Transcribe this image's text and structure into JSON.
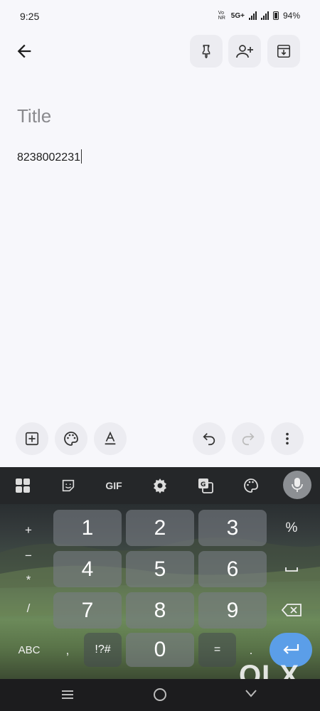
{
  "status_bar": {
    "time": "9:25",
    "network_tag": "Vo NR",
    "network": "5G+",
    "battery": "94%"
  },
  "header": {
    "icons": [
      "back-arrow-icon",
      "pin-icon",
      "add-collaborator-icon",
      "archive-icon"
    ]
  },
  "note": {
    "title_placeholder": "Title",
    "body": "8238002231"
  },
  "editor_toolbar": {
    "left_icons": [
      "add-box-icon",
      "palette-icon",
      "text-format-icon"
    ],
    "right_icons": [
      "undo-icon",
      "redo-icon",
      "more-vert-icon"
    ]
  },
  "keyboard": {
    "toolbar": {
      "gif_label": "GIF",
      "icons": [
        "apps-grid-icon",
        "sticker-icon",
        "gif-icon",
        "settings-icon",
        "translate-icon",
        "theme-palette-icon",
        "mic-icon"
      ]
    },
    "left_column": [
      "+",
      "−",
      "*",
      "/",
      "ABC"
    ],
    "digits": [
      "1",
      "2",
      "3",
      "4",
      "5",
      "6",
      "7",
      "8",
      "9",
      "0"
    ],
    "right_column": [
      "%",
      "␣",
      "⌫",
      "↵"
    ],
    "bottom_row": {
      "comma": ",",
      "symbols": "!?#",
      "equals": "=",
      "period": "."
    }
  },
  "watermark": "OLX",
  "nav_bar": {
    "icons": [
      "recents-icon",
      "home-icon",
      "back-chevron-icon"
    ]
  }
}
